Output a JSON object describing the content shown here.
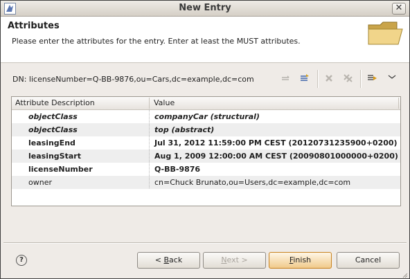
{
  "window": {
    "title": "New Entry"
  },
  "header": {
    "title": "Attributes",
    "description": "Please enter the attributes for the entry. Enter at least the MUST attributes."
  },
  "dn": {
    "label": "DN:",
    "value": "licenseNumber=Q-BB-9876,ou=Cars,dc=example,dc=com"
  },
  "table": {
    "headers": [
      "Attribute Description",
      "Value"
    ],
    "rows": [
      {
        "attribute": "objectClass",
        "value": "companyCar (structural)"
      },
      {
        "attribute": "objectClass",
        "value": "top (abstract)"
      },
      {
        "attribute": "leasingEnd",
        "value": "Jul 31, 2012 11:59:00 PM CEST (20120731235900+0200)"
      },
      {
        "attribute": "leasingStart",
        "value": "Aug 1, 2009 12:00:00 AM CEST (20090801000000+0200)"
      },
      {
        "attribute": "licenseNumber",
        "value": "Q-BB-9876"
      },
      {
        "attribute": "owner",
        "value": "cn=Chuck Brunato,ou=Users,dc=example,dc=com"
      }
    ]
  },
  "buttons": {
    "back_prefix": "< ",
    "back_mnemonic": "B",
    "back_rest": "ack",
    "next_prefix": "",
    "next_mnemonic": "N",
    "next_rest": "ext >",
    "finish_mnemonic": "F",
    "finish_rest": "inish",
    "cancel": "Cancel",
    "help_glyph": "?",
    "close_glyph": "✕"
  },
  "icons": {
    "app": "ldap-app-icon",
    "folder": "folder-icon",
    "toolbar": [
      "move-up-icon",
      "edit-value-icon",
      "delete-icon",
      "delete-all-icon",
      "add-attribute-icon",
      "view-menu-icon"
    ]
  },
  "colors": {
    "finish_accent": "#f0ca8b",
    "alt_row": "#eeeeee",
    "header_bg": "#ffffff",
    "dialog_bg": "#efebe7"
  }
}
